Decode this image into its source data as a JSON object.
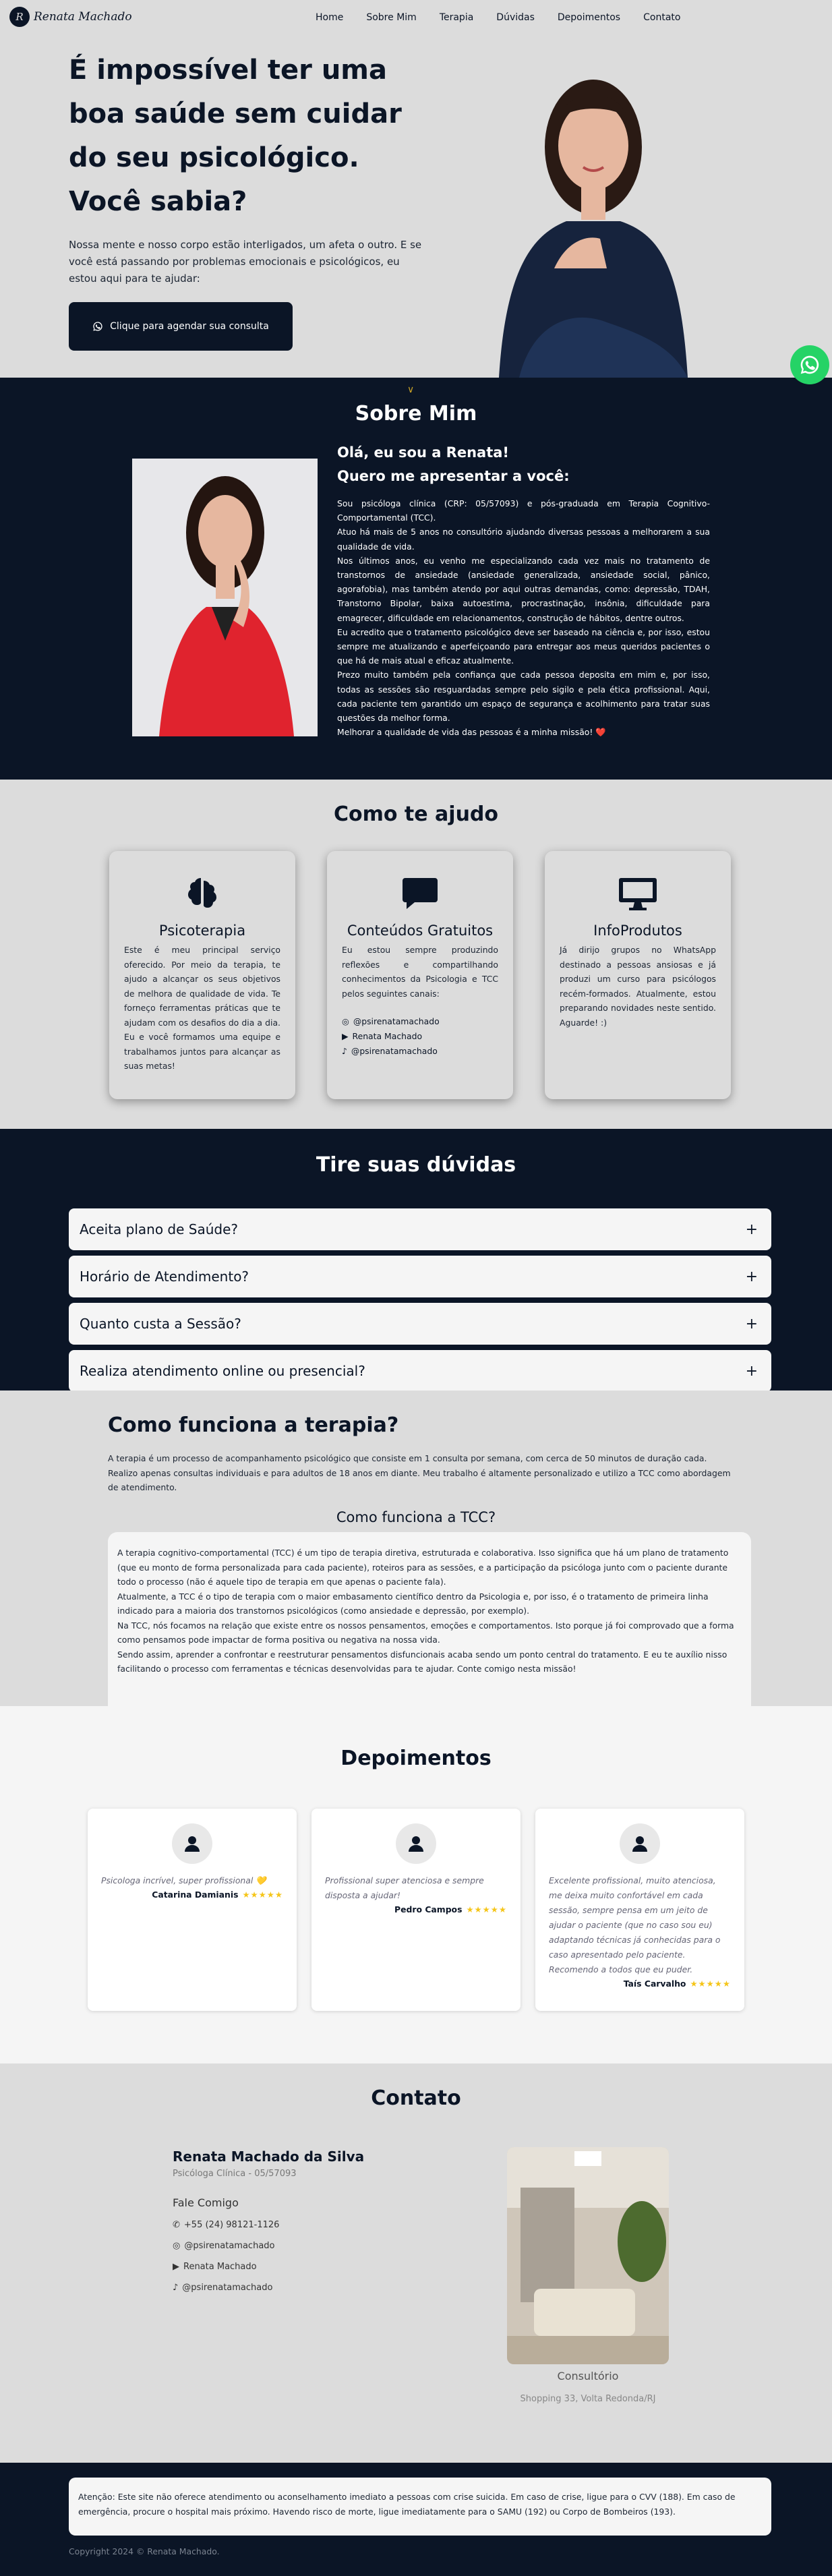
{
  "brand": {
    "name": "Renata Machado",
    "mark": "R"
  },
  "nav": [
    "Home",
    "Sobre Mim",
    "Terapia",
    "Dúvidas",
    "Depoimentos",
    "Contato"
  ],
  "hero": {
    "title": "É impossível ter uma boa saúde sem cuidar do seu psicológico.\nVocê sabia?",
    "text": "Nossa mente e nosso corpo estão interligados, um afeta o outro. E se você está passando por problemas emocionais e psicológicos, eu estou aqui para te ajudar:",
    "cta": "Clique para agendar sua consulta"
  },
  "sobre": {
    "chevron": "∨",
    "title": "Sobre Mim",
    "greet1": "Olá, eu sou a Renata!",
    "greet2": "Quero me apresentar a você:",
    "p1": "Sou psicóloga clínica (CRP: 05/57093) e pós-graduada em Terapia Cognitivo-Comportamental (TCC).",
    "p2": "Atuo há mais de 5 anos no consultório ajudando diversas pessoas a melhorarem a sua qualidade de vida.",
    "p3": "Nos últimos anos, eu venho me especializando cada vez mais no tratamento de transtornos de ansiedade (ansiedade generalizada, ansiedade social, pânico, agorafobia), mas também atendo por aqui outras demandas, como: depressão, TDAH, Transtorno Bipolar, baixa autoestima, procrastinação, insônia, dificuldade para emagrecer, dificuldade em relacionamentos, construção de hábitos, dentre outros.",
    "p4": "Eu acredito que o tratamento psicológico deve ser baseado na ciência e, por isso, estou sempre me atualizando e aperfeiçoando para entregar aos meus queridos pacientes o que há de mais atual e eficaz atualmente.",
    "p5": "Prezo muito também pela confiança que cada pessoa deposita em mim e, por isso, todas as sessões são resguardadas sempre pelo sigilo e pela ética profissional. Aqui, cada paciente tem garantido um espaço de segurança e acolhimento para tratar suas questões da melhor forma.",
    "p6": "Melhorar a qualidade de vida das pessoas é a minha missão! ❤️"
  },
  "ajudo": {
    "title": "Como te ajudo",
    "cards": [
      {
        "title": "Psicoterapia",
        "icon": "brain-icon",
        "text": "Este é meu principal serviço oferecido. Por meio da terapia, te ajudo a alcançar os seus objetivos de melhora de qualidade de vida. Te forneço ferramentas práticas que te ajudam com os desafios do dia a dia. Eu e você formamos uma equipe e trabalhamos juntos para alcançar as suas metas!"
      },
      {
        "title": "Conteúdos Gratuitos",
        "icon": "chat-icon",
        "text": "Eu estou sempre produzindo reflexões e compartilhando conhecimentos da Psicologia e TCC pelos seguintes canais:",
        "social": [
          "@psirenatamachado",
          "Renata Machado",
          "@psirenatamachado"
        ]
      },
      {
        "title": "InfoProdutos",
        "icon": "monitor-icon",
        "text": "Já dirijo grupos no WhatsApp destinado a pessoas ansiosas e já produzi um curso para psicólogos recém-formados. Atualmente, estou preparando novidades neste sentido. Aguarde! :)"
      }
    ]
  },
  "faq": {
    "title": "Tire suas dúvidas",
    "items": [
      "Aceita plano de Saúde?",
      "Horário de Atendimento?",
      "Quanto custa a Sessão?",
      "Realiza atendimento online ou presencial?"
    ],
    "plus": "+"
  },
  "terapia": {
    "title": "Como funciona a terapia?",
    "intro": "A terapia é um processo de acompanhamento psicológico que consiste em 1 consulta por semana, com cerca de 50 minutos de duração cada. Realizo apenas consultas individuais e para adultos de 18 anos em diante. Meu trabalho é altamente personalizado e utilizo a TCC como abordagem de atendimento.",
    "subtitle": "Como funciona a TCC?",
    "p1": "A terapia cognitivo-comportamental (TCC) é um tipo de terapia diretiva, estruturada e colaborativa. Isso significa que há um plano de tratamento (que eu monto de forma personalizada para cada paciente), roteiros para as sessões, e a participação da psicóloga junto com o paciente durante todo o processo (não é aquele tipo de terapia em que apenas o paciente fala).",
    "p2": "Atualmente, a TCC é o tipo de terapia com o maior embasamento científico dentro da Psicologia e, por isso, é o tratamento de primeira linha indicado para a maioria dos transtornos psicológicos (como ansiedade e depressão, por exemplo).",
    "p3": "Na TCC, nós focamos na relação que existe entre os nossos pensamentos, emoções e comportamentos. Isto porque já foi comprovado que a forma como pensamos pode impactar de forma positiva ou negativa na nossa vida.",
    "p4": "Sendo assim, aprender a confrontar e reestruturar pensamentos disfuncionais acaba sendo um ponto central do tratamento. E eu te auxílio nisso facilitando o processo com ferramentas e técnicas desenvolvidas para te ajudar. Conte comigo nesta missão!"
  },
  "depoimentos": {
    "title": "Depoimentos",
    "items": [
      {
        "quote": "Psicologa incrível, super profissional 💛",
        "name": "Catarina Damianis",
        "stars": "★★★★★"
      },
      {
        "quote": "Profissional super atenciosa e sempre disposta a ajudar!",
        "name": "Pedro Campos",
        "stars": "★★★★★"
      },
      {
        "quote": "Excelente profissional, muito atenciosa, me deixa muito confortável em cada sessão, sempre pensa em um jeito de ajudar o paciente (que no caso sou eu) adaptando técnicas já conhecidas para o caso apresentado pelo paciente. Recomendo a todos que eu puder.",
        "name": "Taís Carvalho",
        "stars": "★★★★★"
      }
    ]
  },
  "contato": {
    "title": "Contato",
    "name": "Renata Machado da Silva",
    "sub": "Psicóloga Clínica - 05/57093",
    "head": "Fale Comigo",
    "phone": "+55 (24) 98121-1126",
    "instagram": "@psirenatamachado",
    "youtube": "Renata Machado",
    "tiktok": "@psirenatamachado",
    "caption": "Consultório",
    "address": "Shopping 33, Volta Redonda/RJ"
  },
  "footer": {
    "notice": "Atenção: Este site não oferece atendimento ou aconselhamento imediato a pessoas com crise suicida. Em caso de crise, ligue para o CVV (188). Em caso de emergência, procure o hospital mais próximo. Havendo risco de morte, ligue imediatamente para o SAMU (192) ou Corpo de Bombeiros (193).",
    "copy": "Copyright 2024 © Renata Machado."
  },
  "colors": {
    "navy": "#0b1526",
    "gray": "#dcdcdc",
    "whatsapp": "#25d366",
    "star": "#f5c518"
  }
}
